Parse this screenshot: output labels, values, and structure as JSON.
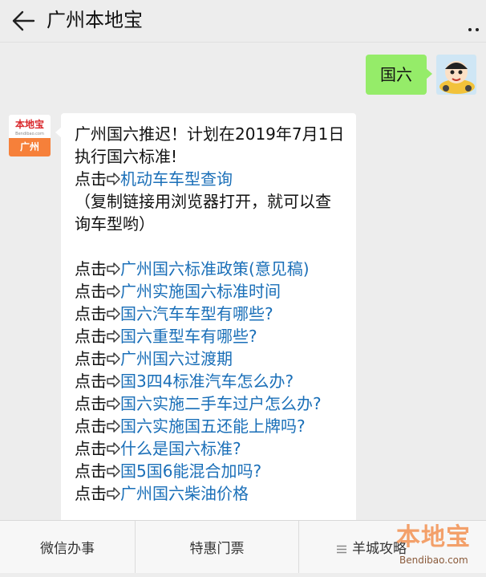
{
  "header": {
    "title": "广州本地宝"
  },
  "user_message": {
    "text": "国六"
  },
  "bot_avatar": {
    "logo_text": "本地宝",
    "logo_url": "Bendibao.com",
    "city": "广州"
  },
  "bot_message": {
    "intro": "广州国六推迟！计划在2019年7月1日执行国六标准!",
    "prefix": "点击",
    "first_link": "机动车车型查询",
    "note": "（复制链接用浏览器打开，就可以查询车型哟）",
    "links": [
      "广州国六标准政策(意见稿)",
      "广州实施国六标准时间",
      "国六汽车车型有哪些?",
      "国六重型车有哪些?",
      "广州国六过渡期",
      "国3四4标准汽车怎么办?",
      "国六实施二手车过户怎么办?",
      "国六实施国五还能上牌吗?",
      "什么是国六标准?",
      "国5国6能混合加吗?",
      "广州国六柴油价格"
    ]
  },
  "bottom_menu": {
    "items": [
      "微信办事",
      "特惠门票",
      "羊城攻略"
    ]
  },
  "watermark": {
    "main": "本地宝",
    "url": "Bendibao.com"
  },
  "colors": {
    "link": "#1a6fb8",
    "user_bubble": "#95ec69",
    "brand_orange": "#f6803a"
  }
}
